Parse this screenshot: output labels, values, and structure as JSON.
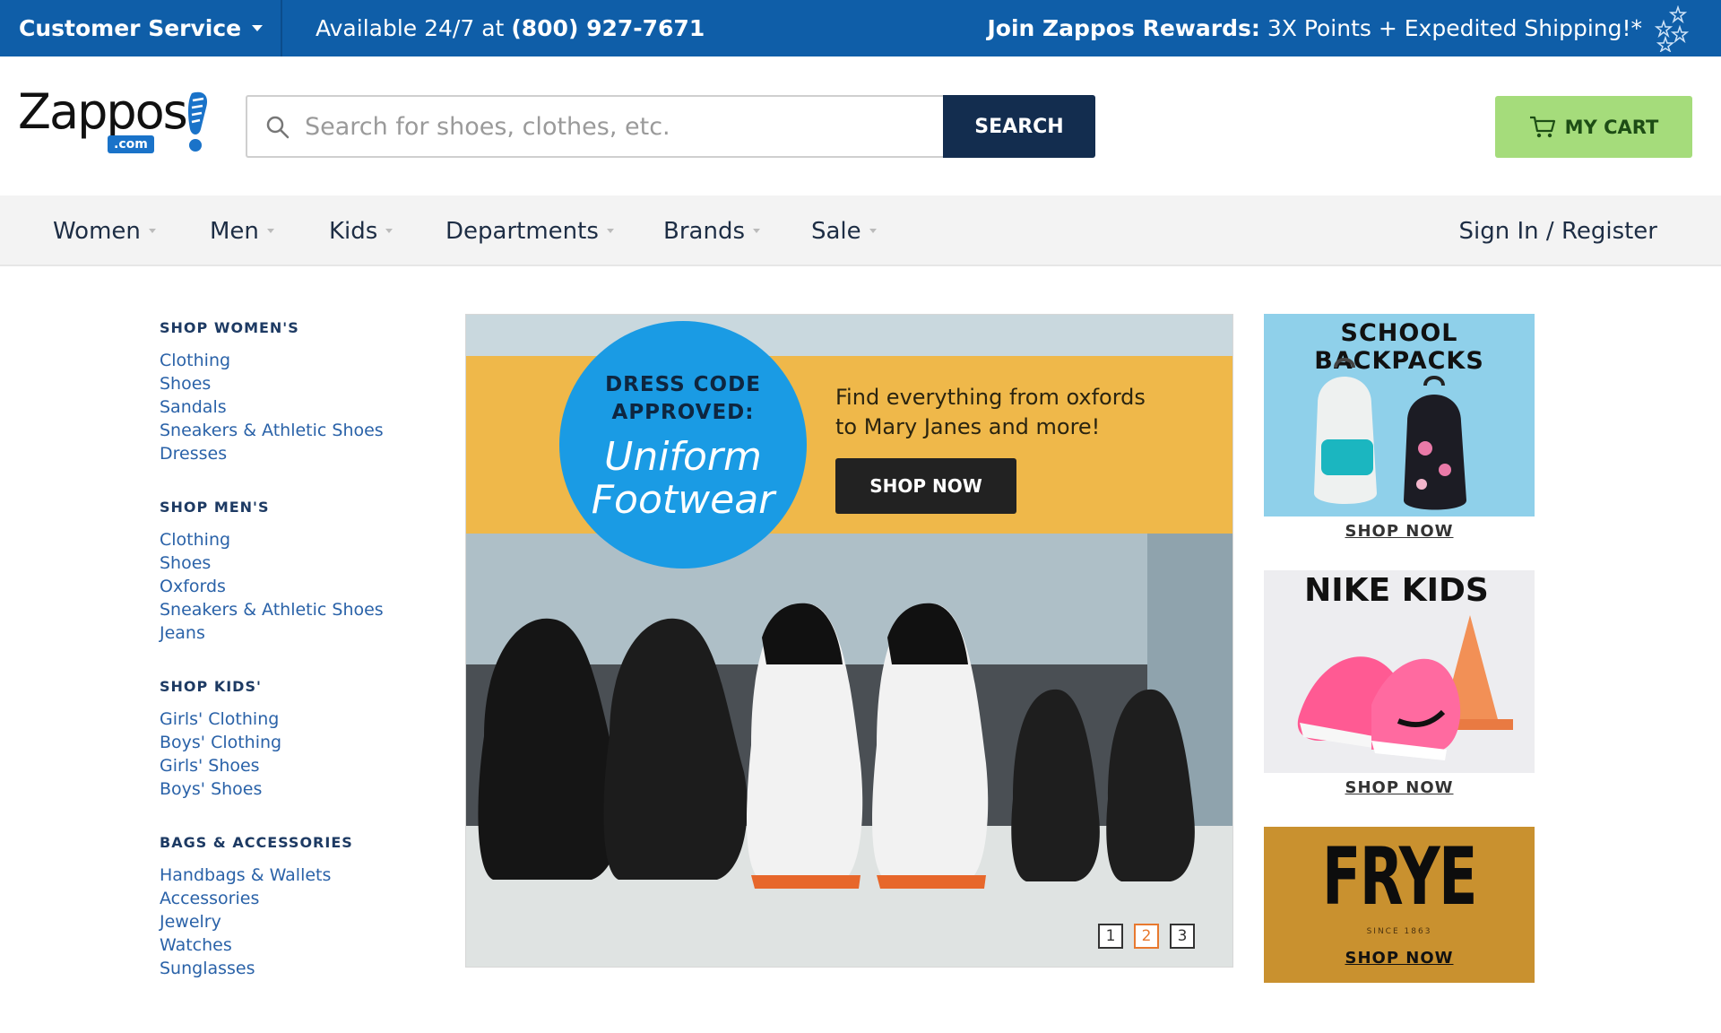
{
  "topbar": {
    "customer_service": "Customer Service",
    "available_text": "Available 24/7 at",
    "phone": "(800) 927-7671",
    "rewards_label": "Join Zappos Rewards:",
    "rewards_offer": "3X Points + Expedited Shipping!*"
  },
  "header": {
    "logo_text": "Zappos",
    "logo_suffix": ".com",
    "search": {
      "placeholder": "Search for shoes, clothes, etc.",
      "value": "",
      "button_label": "SEARCH"
    },
    "cart_label": "MY CART"
  },
  "nav": {
    "items": [
      {
        "label": "Women"
      },
      {
        "label": "Men"
      },
      {
        "label": "Kids"
      },
      {
        "label": "Departments"
      },
      {
        "label": "Brands"
      },
      {
        "label": "Sale"
      }
    ],
    "signin": "Sign In / Register"
  },
  "sidebar": {
    "groups": [
      {
        "heading": "SHOP WOMEN'S",
        "links": [
          "Clothing",
          "Shoes",
          "Sandals",
          "Sneakers & Athletic Shoes",
          "Dresses"
        ]
      },
      {
        "heading": "SHOP MEN'S",
        "links": [
          "Clothing",
          "Shoes",
          "Oxfords",
          "Sneakers & Athletic Shoes",
          "Jeans"
        ]
      },
      {
        "heading": "SHOP KIDS'",
        "links": [
          "Girls' Clothing",
          "Boys' Clothing",
          "Girls' Shoes",
          "Boys' Shoes"
        ]
      },
      {
        "heading": "BAGS & ACCESSORIES",
        "links": [
          "Handbags & Wallets",
          "Accessories",
          "Jewelry",
          "Watches",
          "Sunglasses"
        ]
      }
    ]
  },
  "hero": {
    "circle_line1": "DRESS CODE",
    "circle_line2": "APPROVED:",
    "circle_big1": "Uniform",
    "circle_big2": "Footwear",
    "copy_line1": "Find everything from oxfords",
    "copy_line2": "to Mary Janes and more!",
    "button_label": "SHOP NOW",
    "pager": [
      "1",
      "2",
      "3"
    ],
    "active_page": "2"
  },
  "promos": {
    "backpacks": {
      "title": "SCHOOL BACKPACKS",
      "link": "SHOP NOW"
    },
    "nike_kids": {
      "title": "NIKE KIDS",
      "link": "SHOP NOW"
    },
    "frye": {
      "title": "FRYE",
      "since": "SINCE 1863",
      "link": "SHOP NOW"
    }
  },
  "colors": {
    "topbar": "#0f5ea8",
    "search_button": "#132d4f",
    "cart_button": "#a5dc7b",
    "link_blue": "#2a62a8",
    "hero_band": "#efb84a",
    "hero_circle": "#1a9be4",
    "active_page": "#e8792f"
  },
  "icons": [
    "chevron-down-icon",
    "stars-icon",
    "search-icon",
    "cart-icon",
    "shoe-logo-icon"
  ]
}
